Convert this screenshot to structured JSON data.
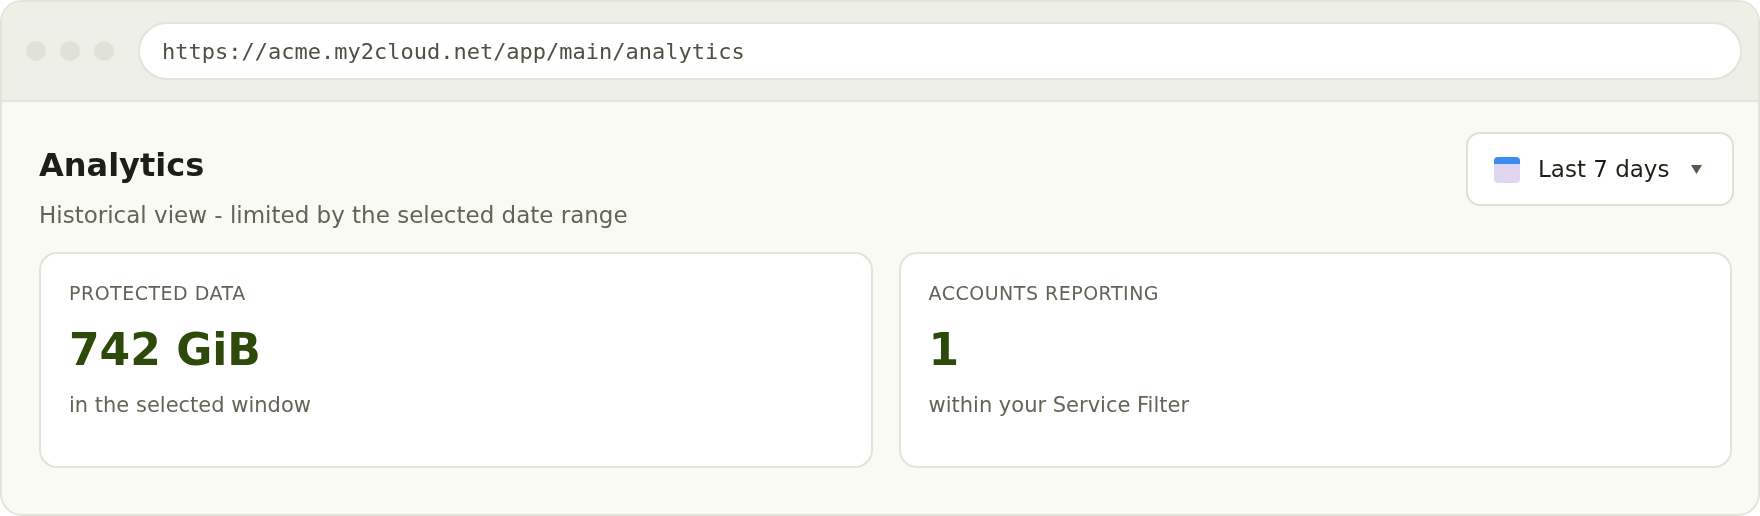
{
  "browser": {
    "url": "https://acme.my2cloud.net/app/main/analytics"
  },
  "page": {
    "title": "Analytics",
    "subtitle": "Historical view - limited by the selected date range"
  },
  "date_range": {
    "label": "Last 7 days"
  },
  "cards": [
    {
      "label": "PROTECTED DATA",
      "value": "742 GiB",
      "note": "in the selected window"
    },
    {
      "label": "ACCOUNTS REPORTING",
      "value": "1",
      "note": "within your Service Filter"
    }
  ]
}
